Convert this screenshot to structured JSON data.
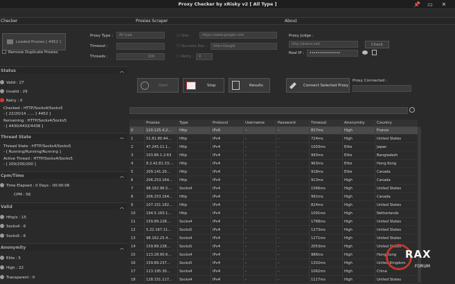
{
  "window": {
    "title": "Proxy Checker by xRisky v2 [ All Type ]",
    "pin": "📌",
    "restore": "▭",
    "close": "✕"
  },
  "tabs": [
    "Checker",
    "Proxies Scraper",
    "About"
  ],
  "checker": {
    "load_btn": "Loaded Proxies [ 4452 ]",
    "remove_dup": "Remove Duplicate Proxies",
    "proxy_type_label": "Proxy Type :",
    "proxy_type_value": "All type",
    "timeout_label": "Timeout :",
    "timeout_value": "",
    "threads_label": "Threads :",
    "threads_value": "200"
  },
  "scraper": {
    "site_label": "Site :",
    "site_value": "https://www.google.com",
    "success_label": "Success Key :",
    "success_value": "title>Google",
    "retry_label": "Retry :",
    "retry_value": "0"
  },
  "about": {
    "judge_label": "Proxy Judge :",
    "judge_value": "http://azenv.net/",
    "check_btn": "Check",
    "realip_label": "Real IP :",
    "realip_value": "•••••••••••••••"
  },
  "actions": {
    "start": "Start",
    "stop": "Stop",
    "results": "Results",
    "connect": "Connect Selected Proxy",
    "connected_label": "Proxy Connected :"
  },
  "stats": {
    "status_head": "Status",
    "valid": "Valid : 27",
    "invalid": "Invalid : 29",
    "retry": "Retry : 0",
    "checked": "Checked : HTTP/Socks4/Socks5",
    "checked2": "- [ 22/20/14 ...... [ 4452 ]",
    "remaining": "Remaining : HTTP/Socks4/Socks5",
    "remaining2": "- [ 4430/4432/4438 ]",
    "thread_head": "Thread State",
    "thread_state": "Thread State : HTTP/Socks4/Socks5",
    "thread_state2": "- [ Running/Running/Running ]",
    "active_thread": "Active Thread : HTTP/Socks4/Socks5",
    "active_thread2": "- [ 200/200/200 ]",
    "cpm_head": "Cpm/Time",
    "elapsed": "Time Elapsed : 0 Days - 00:00:06",
    "cpm": "CPM : 56",
    "valid_head": "Valid",
    "https": "Http/s : 15",
    "socks4": "Socks4 : 6",
    "socks5": "Socks5 : 6",
    "anon_head": "Anonymity",
    "elite": "Elite : 5",
    "high": "High : 22",
    "transparent": "Transparent : 0"
  },
  "table": {
    "headers": [
      "Proxies",
      "Type",
      "Protocol",
      "Username",
      "Password",
      "Timeout",
      "Anonymity",
      "Country"
    ],
    "rows": [
      [
        "0",
        "120.125.4.2...",
        "Http",
        "IPv6",
        "-",
        "-",
        "817ms",
        "High",
        "France"
      ],
      [
        "1",
        "51.81.80.44...",
        "Http",
        "IPv4",
        "-",
        "-",
        "724ms",
        "High",
        "United States"
      ],
      [
        "2",
        "47.245.11.1...",
        "Http",
        "IPv4",
        "-",
        "-",
        "1003ms",
        "Elite",
        "Japan"
      ],
      [
        "3",
        "103.86.1.2:63",
        "Http",
        "IPv4",
        "-",
        "-",
        "993ms",
        "Elite",
        "Bangladesh"
      ],
      [
        "4",
        "8.2.42.81.33:...",
        "Http",
        "IPv4",
        "-",
        "-",
        "963ms",
        "Elite",
        "Hong Kong"
      ],
      [
        "5",
        "209.141.20...",
        "Http",
        "IPv4",
        "-",
        "-",
        "918ms",
        "Elite",
        "Canada"
      ],
      [
        "6",
        "206.253.164...",
        "Http",
        "IPv4",
        "-",
        "-",
        "913ms",
        "High",
        "Canada"
      ],
      [
        "7",
        "98.162.96.5...",
        "Socks4",
        "IPv4",
        "-",
        "-",
        "1566ms",
        "High",
        "United States"
      ],
      [
        "8",
        "206.253.164...",
        "Http",
        "IPv4",
        "-",
        "-",
        "991ms",
        "High",
        "Canada"
      ],
      [
        "9",
        "107.151.182...",
        "Http",
        "IPv4",
        "-",
        "-",
        "824ms",
        "High",
        "United States"
      ],
      [
        "10",
        "194.5.193.1...",
        "Http",
        "IPv4",
        "-",
        "-",
        "1091ms",
        "High",
        "Netherlands"
      ],
      [
        "11",
        "159.89.228...",
        "Socks4",
        "IPv4",
        "-",
        "-",
        "1768ms",
        "High",
        "United States"
      ],
      [
        "12",
        "5.22.167.11...",
        "Socks5",
        "IPv4",
        "-",
        "-",
        "1273ms",
        "High",
        "United States"
      ],
      [
        "13",
        "98.162.25.4...",
        "Socks4",
        "IPv4",
        "-",
        "-",
        "1271ms",
        "High",
        "United States"
      ],
      [
        "14",
        "159.89.228...",
        "Socks5",
        "IPv4",
        "-",
        "-",
        "2053ms",
        "High",
        "United States"
      ],
      [
        "15",
        "113.28.90.6...",
        "Socks4",
        "IPv4",
        "-",
        "-",
        "986ms",
        "High",
        "Hong Kong"
      ],
      [
        "16",
        "159.89.237...",
        "Socks5",
        "IPv4",
        "-",
        "-",
        "1302ms",
        "High",
        "United Kingdom"
      ],
      [
        "17",
        "113.195.30...",
        "Socks4",
        "IPv4",
        "-",
        "-",
        "1062ms",
        "High",
        "China"
      ],
      [
        "18",
        "128.151.117...",
        "Socks4",
        "IPv4",
        "-",
        "-",
        "1117ms",
        "High",
        "United States"
      ]
    ]
  },
  "watermark": {
    "brand": "RAX",
    "sub": "FORUM"
  }
}
